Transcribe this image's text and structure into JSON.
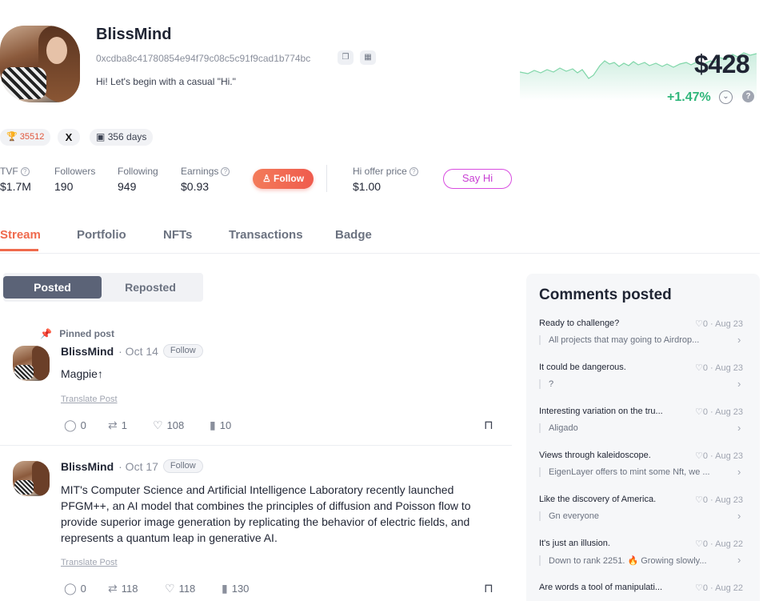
{
  "profile": {
    "name": "BlissMind",
    "address": "0xcdba8c41780854e94f79c08c5c91f9cad1b774bc",
    "bio": "Hi! Let's begin with a casual \"Hi.\"",
    "price": "$428",
    "change": "+1.47%",
    "trophy_count": "35512",
    "x_label": "X",
    "days": "356 days"
  },
  "stats": {
    "tvf_label": "TVF",
    "tvf_value": "$1.7M",
    "followers_label": "Followers",
    "followers_value": "190",
    "following_label": "Following",
    "following_value": "949",
    "earnings_label": "Earnings",
    "earnings_value": "$0.93",
    "follow_button": "Follow",
    "hi_offer_label": "Hi offer price",
    "hi_offer_value": "$1.00",
    "say_hi_button": "Say Hi"
  },
  "tabs": [
    "Stream",
    "Portfolio",
    "NFTs",
    "Transactions",
    "Badge"
  ],
  "segment": {
    "posted": "Posted",
    "reposted": "Reposted"
  },
  "posts": [
    {
      "pinned_label": "Pinned post",
      "author": "BlissMind",
      "date": "· Oct 14",
      "follow": "Follow",
      "text": "Magpie↑",
      "translate": "Translate Post",
      "comments": "0",
      "reposts": "1",
      "likes": "108",
      "views": "10"
    },
    {
      "author": "BlissMind",
      "date": "· Oct 17",
      "follow": "Follow",
      "text": "MIT's Computer Science and Artificial Intelligence Laboratory recently launched PFGM++, an AI model that combines the principles of diffusion and Poisson flow to provide superior image generation by replicating the behavior of electric fields, and represents a quantum leap in generative AI.",
      "translate": "Translate Post",
      "comments": "0",
      "reposts": "118",
      "likes": "118",
      "views": "130"
    }
  ],
  "comments_panel": {
    "title": "Comments posted",
    "items": [
      {
        "title": "Ready to challenge?",
        "meta": "♡0 · Aug 23",
        "reply": "All projects that may going to Airdrop..."
      },
      {
        "title": "It could be dangerous.",
        "meta": "♡0 · Aug 23",
        "reply": "?"
      },
      {
        "title": "Interesting variation on the tru...",
        "meta": "♡0 · Aug 23",
        "reply": "Aligado"
      },
      {
        "title": "Views through kaleidoscope.",
        "meta": "♡0 · Aug 23",
        "reply": "EigenLayer offers to mint some Nft, we ..."
      },
      {
        "title": "Like the discovery of America.",
        "meta": "♡0 · Aug 23",
        "reply": "Gn everyone"
      },
      {
        "title": "It's just an illusion.",
        "meta": "♡0 · Aug 22",
        "reply": "Down to rank 2251. 🔥 Growing slowly..."
      },
      {
        "title": "Are words a tool of manipulati...",
        "meta": "♡0 · Aug 22",
        "reply": ""
      }
    ]
  },
  "colors": {
    "accent": "#ef6a4d",
    "positive": "#2fb67a",
    "say_hi": "#d84ce0"
  }
}
